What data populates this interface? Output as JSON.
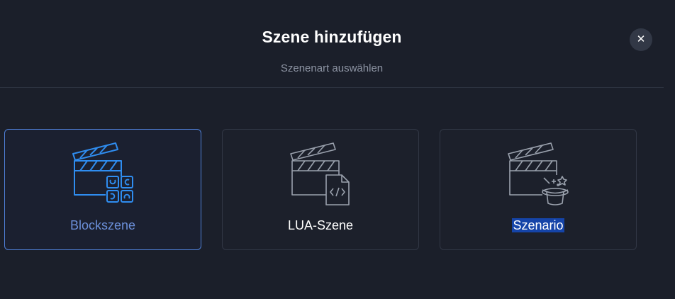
{
  "dialog": {
    "title": "Szene hinzufügen",
    "subtitle": "Szenenart auswählen",
    "close_icon": "close-icon"
  },
  "cards": [
    {
      "label": "Blockszene",
      "icon": "clapperboard-blocks-icon",
      "selected": true
    },
    {
      "label": "LUA-Szene",
      "icon": "clapperboard-code-icon",
      "selected": false
    },
    {
      "label": "Szenario",
      "icon": "clapperboard-magic-hat-icon",
      "selected": false
    }
  ],
  "colors": {
    "background": "#1b1f2a",
    "selected_border": "#4f7fd6",
    "selected_icon": "#2f8df0",
    "selected_label": "#6b8fd9",
    "icon_gray": "#9aa1ad",
    "text_highlight": "#1544a8"
  }
}
